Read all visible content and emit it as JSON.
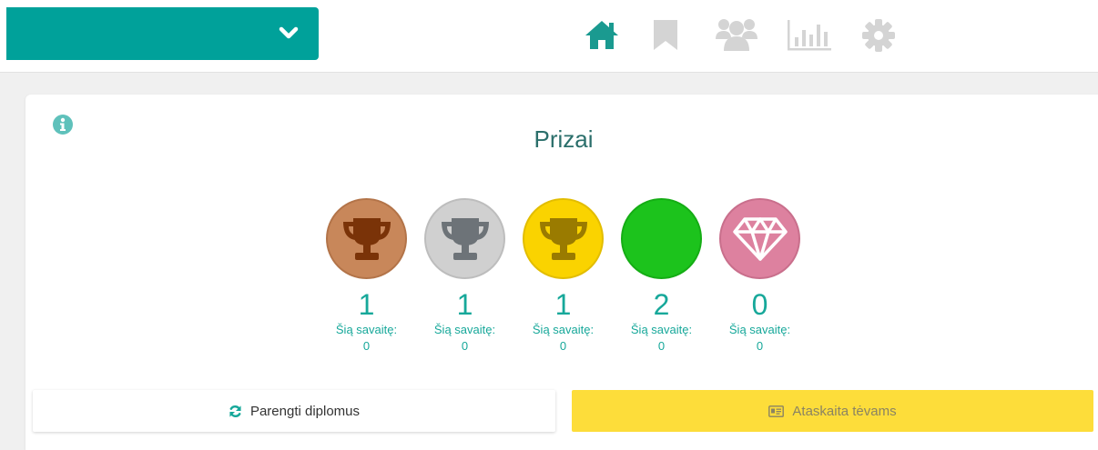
{
  "nav": {
    "selector_value": "",
    "icons": [
      "chevron-down-icon",
      "home-icon",
      "bookmark-icon",
      "users-icon",
      "bar-chart-icon",
      "gear-icon"
    ],
    "active_color": "#1a9a90",
    "inactive_color": "#d4d4d4"
  },
  "card": {
    "title": "Prizai",
    "info_icon": "info-icon"
  },
  "prizes": [
    {
      "icon": "trophy-icon",
      "color": "#c8875a",
      "count": "1",
      "week_label": "Šią savaitę:",
      "week_value": "0"
    },
    {
      "icon": "trophy-icon",
      "color": "#d0d0d0",
      "count": "1",
      "week_label": "Šią savaitę:",
      "week_value": "0"
    },
    {
      "icon": "trophy-icon",
      "color": "#fad300",
      "count": "1",
      "week_label": "Šią savaitę:",
      "week_value": "0"
    },
    {
      "icon": "",
      "color": "#1cc31c",
      "count": "2",
      "week_label": "Šią savaitę:",
      "week_value": "0"
    },
    {
      "icon": "diamond-icon",
      "color": "#dd819f",
      "count": "0",
      "week_label": "Šią savaitę:",
      "week_value": "0"
    }
  ],
  "buttons": {
    "diplomas_label": "Parengti diplomus",
    "report_label": "Ataskaita tėvams"
  },
  "colors": {
    "brand": "#00a19a",
    "accent_text": "#17a89a",
    "report_button": "#fddd3a"
  }
}
